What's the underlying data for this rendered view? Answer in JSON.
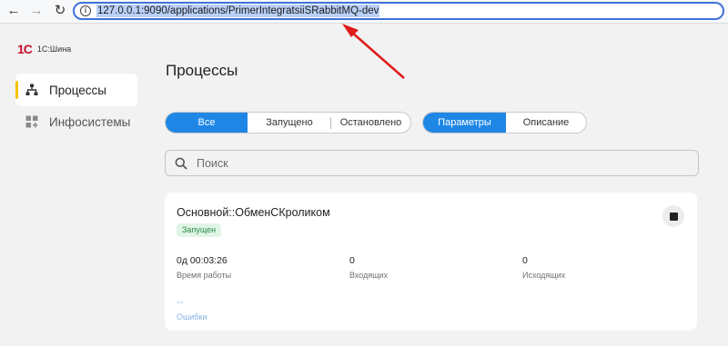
{
  "browser": {
    "url": "127.0.0.1:9090/applications/PrimerIntegratsiiSRabbitMQ-dev"
  },
  "logo": {
    "mark": "1С",
    "name": "1С:Шина"
  },
  "sidebar": {
    "items": [
      {
        "label": "Процессы",
        "icon": "hierarchy-icon",
        "active": true
      },
      {
        "label": "Инфосистемы",
        "icon": "grid-plus-icon",
        "active": false
      }
    ]
  },
  "main": {
    "title": "Процессы",
    "filter_tabs": [
      "Все",
      "Запущено",
      "Остановлено"
    ],
    "filter_selected": "Все",
    "view_tabs": [
      "Параметры",
      "Описание"
    ],
    "view_selected": "Параметры",
    "search": {
      "placeholder": "Поиск"
    }
  },
  "process_card": {
    "title": "Основной::ОбменСКроликом",
    "status": "Запущен",
    "metrics": [
      {
        "value": "0д 00:03:26",
        "label": "Время работы"
      },
      {
        "value": "0",
        "label": "Входящих"
      },
      {
        "value": "0",
        "label": "Исходящих"
      },
      {
        "value": "--",
        "label": "Ошибки"
      }
    ]
  },
  "colors": {
    "accent": "#1e87e5",
    "active_marker": "#f5c400",
    "status_bg": "#e1f5e6",
    "status_text": "#2b8a46"
  }
}
